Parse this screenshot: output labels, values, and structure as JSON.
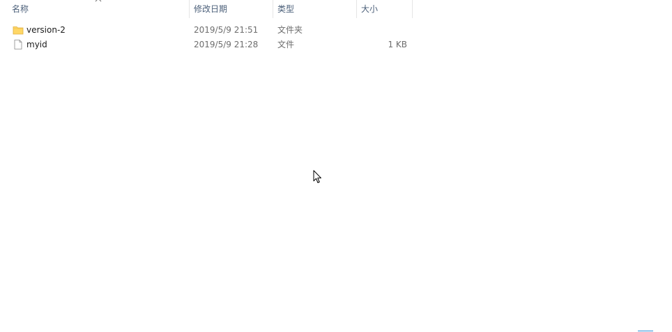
{
  "columns": {
    "name": "名称",
    "date": "修改日期",
    "type": "类型",
    "size": "大小"
  },
  "sort": {
    "column": "name",
    "direction": "ascending",
    "icon": "chevron-up-icon"
  },
  "files": [
    {
      "name": "version-2",
      "date": "2019/5/9 21:51",
      "type": "文件夹",
      "size": "",
      "icon": "folder-icon"
    },
    {
      "name": "myid",
      "date": "2019/5/9 21:28",
      "type": "文件",
      "size": "1 KB",
      "icon": "file-icon"
    }
  ],
  "colors": {
    "header_text": "#4c607a",
    "detail_text": "#6d6d6d",
    "folder_fill": "#ffd766",
    "folder_edge": "#e0b040"
  }
}
